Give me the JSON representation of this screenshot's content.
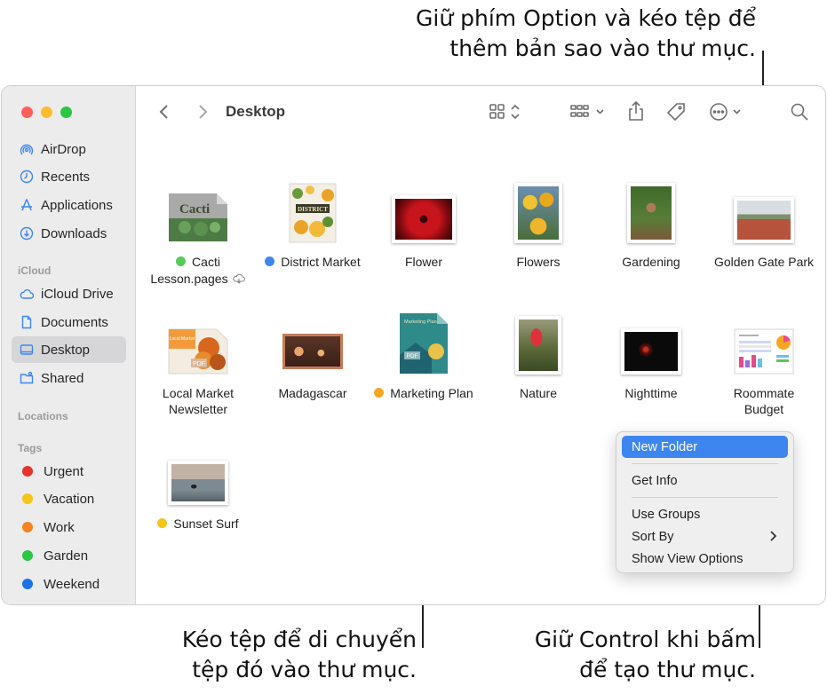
{
  "callouts": {
    "top_line1": "Giữ phím Option và kéo tệp để",
    "top_line2": "thêm bản sao vào thư mục.",
    "bottom_left_line1": "Kéo tệp để di chuyển",
    "bottom_left_line2": "tệp đó vào thư mục.",
    "bottom_right_line1": "Giữ Control khi bấm",
    "bottom_right_line2": "để tạo thư mục."
  },
  "toolbar": {
    "title": "Desktop"
  },
  "sidebar": {
    "favorites": [
      {
        "label": "AirDrop",
        "icon": "airdrop-icon"
      },
      {
        "label": "Recents",
        "icon": "clock-icon"
      },
      {
        "label": "Applications",
        "icon": "applications-icon"
      },
      {
        "label": "Downloads",
        "icon": "download-icon"
      }
    ],
    "icloud_header": "iCloud",
    "icloud": [
      {
        "label": "iCloud Drive",
        "icon": "cloud-icon"
      },
      {
        "label": "Documents",
        "icon": "document-icon"
      },
      {
        "label": "Desktop",
        "icon": "desktop-icon",
        "selected": true
      },
      {
        "label": "Shared",
        "icon": "shared-folder-icon"
      }
    ],
    "locations_header": "Locations",
    "tags_header": "Tags",
    "tags": [
      {
        "label": "Urgent",
        "color": "#e8332a"
      },
      {
        "label": "Vacation",
        "color": "#f5c518"
      },
      {
        "label": "Work",
        "color": "#f5831f"
      },
      {
        "label": "Garden",
        "color": "#28c840"
      },
      {
        "label": "Weekend",
        "color": "#1a73e8"
      }
    ]
  },
  "files": [
    {
      "line1": "Cacti",
      "line2": "Lesson.pages",
      "tag_color": "#5ac85a",
      "cloud": true
    },
    {
      "line1": "District Market",
      "line2": "",
      "tag_color": "#3d86f0"
    },
    {
      "line1": "Flower",
      "line2": ""
    },
    {
      "line1": "Flowers",
      "line2": ""
    },
    {
      "line1": "Gardening",
      "line2": ""
    },
    {
      "line1": "Golden Gate Park",
      "line2": ""
    },
    {
      "line1": "Local Market",
      "line2": "Newsletter"
    },
    {
      "line1": "Madagascar",
      "line2": ""
    },
    {
      "line1": "Marketing Plan",
      "line2": "",
      "tag_color": "#f5a623"
    },
    {
      "line1": "Nature",
      "line2": ""
    },
    {
      "line1": "Nighttime",
      "line2": ""
    },
    {
      "line1": "Roommate",
      "line2": "Budget"
    },
    {
      "line1": "Sunset Surf",
      "line2": "",
      "tag_color": "#f5c518"
    }
  ],
  "thumb_text": {
    "cacti": "Cacti",
    "district": "DISTRICT",
    "marketing": "Marketing Plan",
    "local_market": "Local Market",
    "pdf": "PDF"
  },
  "context_menu": {
    "new_folder": "New Folder",
    "get_info": "Get Info",
    "use_groups": "Use Groups",
    "sort_by": "Sort By",
    "show_view_options": "Show View Options"
  }
}
